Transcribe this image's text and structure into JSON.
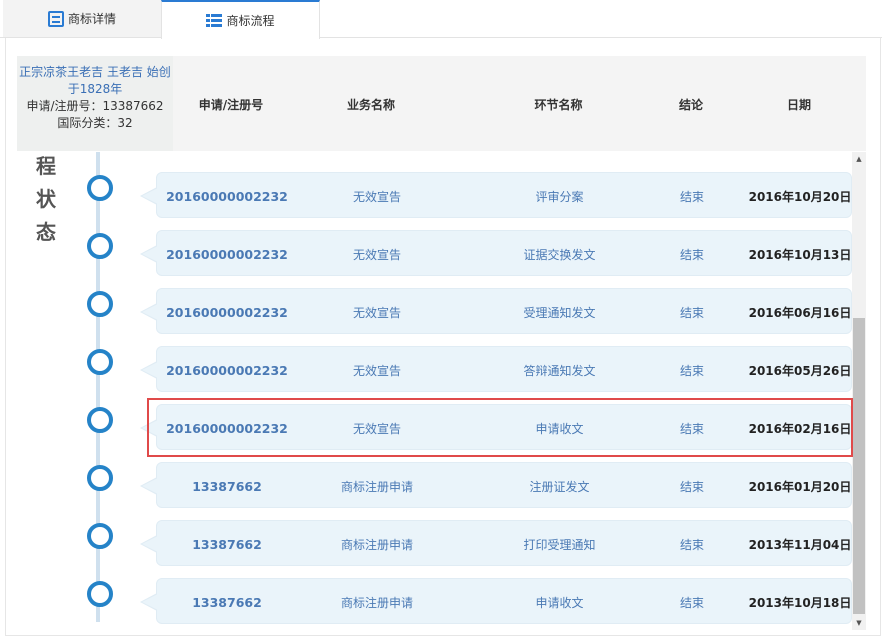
{
  "tabs": [
    {
      "label": "商标详情",
      "icon": "document-icon",
      "active": false
    },
    {
      "label": "商标流程",
      "icon": "list-icon",
      "active": true
    }
  ],
  "mark_info": {
    "name_line1": "正宗凉茶王老吉 王老吉 始创",
    "name_line2": "于1828年",
    "reg_no": "申请/注册号：13387662",
    "class": "国际分类：32"
  },
  "table": {
    "headers": [
      "申请/注册号",
      "业务名称",
      "环节名称",
      "结论",
      "日期"
    ]
  },
  "side_status": [
    "程",
    "状",
    "态"
  ],
  "rows": [
    {
      "number": "20160000002232",
      "business": "无效宣告",
      "step": "评审分案",
      "result": "结束",
      "date": "2016年10月20日"
    },
    {
      "number": "20160000002232",
      "business": "无效宣告",
      "step": "证据交换发文",
      "result": "结束",
      "date": "2016年10月13日"
    },
    {
      "number": "20160000002232",
      "business": "无效宣告",
      "step": "受理通知发文",
      "result": "结束",
      "date": "2016年06月16日"
    },
    {
      "number": "20160000002232",
      "business": "无效宣告",
      "step": "答辩通知发文",
      "result": "结束",
      "date": "2016年05月26日"
    },
    {
      "number": "20160000002232",
      "business": "无效宣告",
      "step": "申请收文",
      "result": "结束",
      "date": "2016年02月16日",
      "highlighted": true
    },
    {
      "number": "13387662",
      "business": "商标注册申请",
      "step": "注册证发文",
      "result": "结束",
      "date": "2016年01月20日"
    },
    {
      "number": "13387662",
      "business": "商标注册申请",
      "step": "打印受理通知",
      "result": "结束",
      "date": "2013年11月04日"
    },
    {
      "number": "13387662",
      "business": "商标注册申请",
      "step": "申请收文",
      "result": "结束",
      "date": "2013年10月18日"
    }
  ],
  "colors": {
    "accent": "#2583c8",
    "highlight": "#e04a4a",
    "row_bg": "#eaf4fa"
  }
}
